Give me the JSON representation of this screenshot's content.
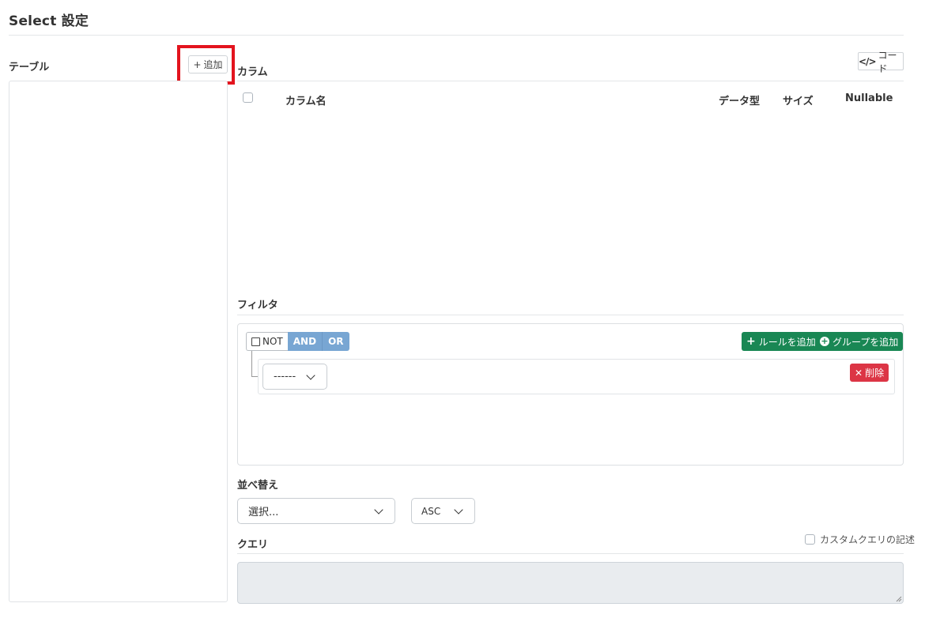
{
  "page": {
    "title": "Select 設定"
  },
  "table_panel": {
    "label": "テーブル",
    "add_button": "追加",
    "add_icon": "+"
  },
  "columns": {
    "label": "カラム",
    "code_button": "コード",
    "code_icon": "</>",
    "headers": {
      "name": "カラム名",
      "type": "データ型",
      "size": "サイズ",
      "nullable": "Nullable"
    }
  },
  "filter": {
    "label": "フィルタ",
    "not_label": "NOT",
    "and_label": "AND",
    "or_label": "OR",
    "add_rule": "ルールを追加",
    "add_group": "グループを追加",
    "rule_select_value": "------",
    "delete_label": "削除",
    "colors": {
      "logic": "#78a6d3",
      "add": "#198754",
      "delete": "#dc3545"
    }
  },
  "sort": {
    "label": "並べ替え",
    "field_value": "選択...",
    "order_value": "ASC"
  },
  "query": {
    "label": "クエリ",
    "custom_label": "カスタムクエリの記述",
    "text": ""
  },
  "highlight": {
    "color": "#e3141e"
  }
}
